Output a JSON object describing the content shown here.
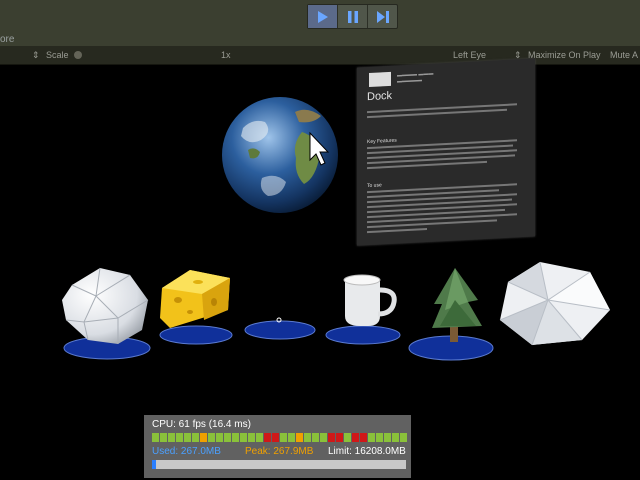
{
  "toolbar": {
    "play_icon": "play-icon",
    "pause_icon": "pause-icon",
    "step_icon": "step-icon",
    "left_text": "ore"
  },
  "game_view": {
    "scale_label": "Scale",
    "scale_value": "1x",
    "display": "Left Eye",
    "maximize": "Maximize On Play",
    "mute": "Mute A"
  },
  "panel": {
    "title": "Dock",
    "section_features": "Key Features",
    "section_usage": "To use"
  },
  "perf": {
    "cpu": "CPU: 61 fps (16.4 ms)",
    "used": "Used: 267.0MB",
    "peak": "Peak: 267.9MB",
    "limit": "Limit: 16208.0MB",
    "mem_fraction": 0.016,
    "bar_colors": [
      "g",
      "g",
      "g",
      "g",
      "g",
      "g",
      "o",
      "g",
      "g",
      "g",
      "g",
      "g",
      "g",
      "g",
      "r",
      "r",
      "g",
      "g",
      "o",
      "g",
      "g",
      "g",
      "r",
      "r",
      "g",
      "r",
      "r",
      "g",
      "g",
      "g",
      "g",
      "g"
    ],
    "colors": {
      "g": "#8ac13a",
      "o": "#f0a000",
      "r": "#d01818"
    }
  },
  "scene_objects": [
    "globe",
    "geodesic-sphere",
    "cheese",
    "empty-slot",
    "mug",
    "tree",
    "icosahedron"
  ]
}
